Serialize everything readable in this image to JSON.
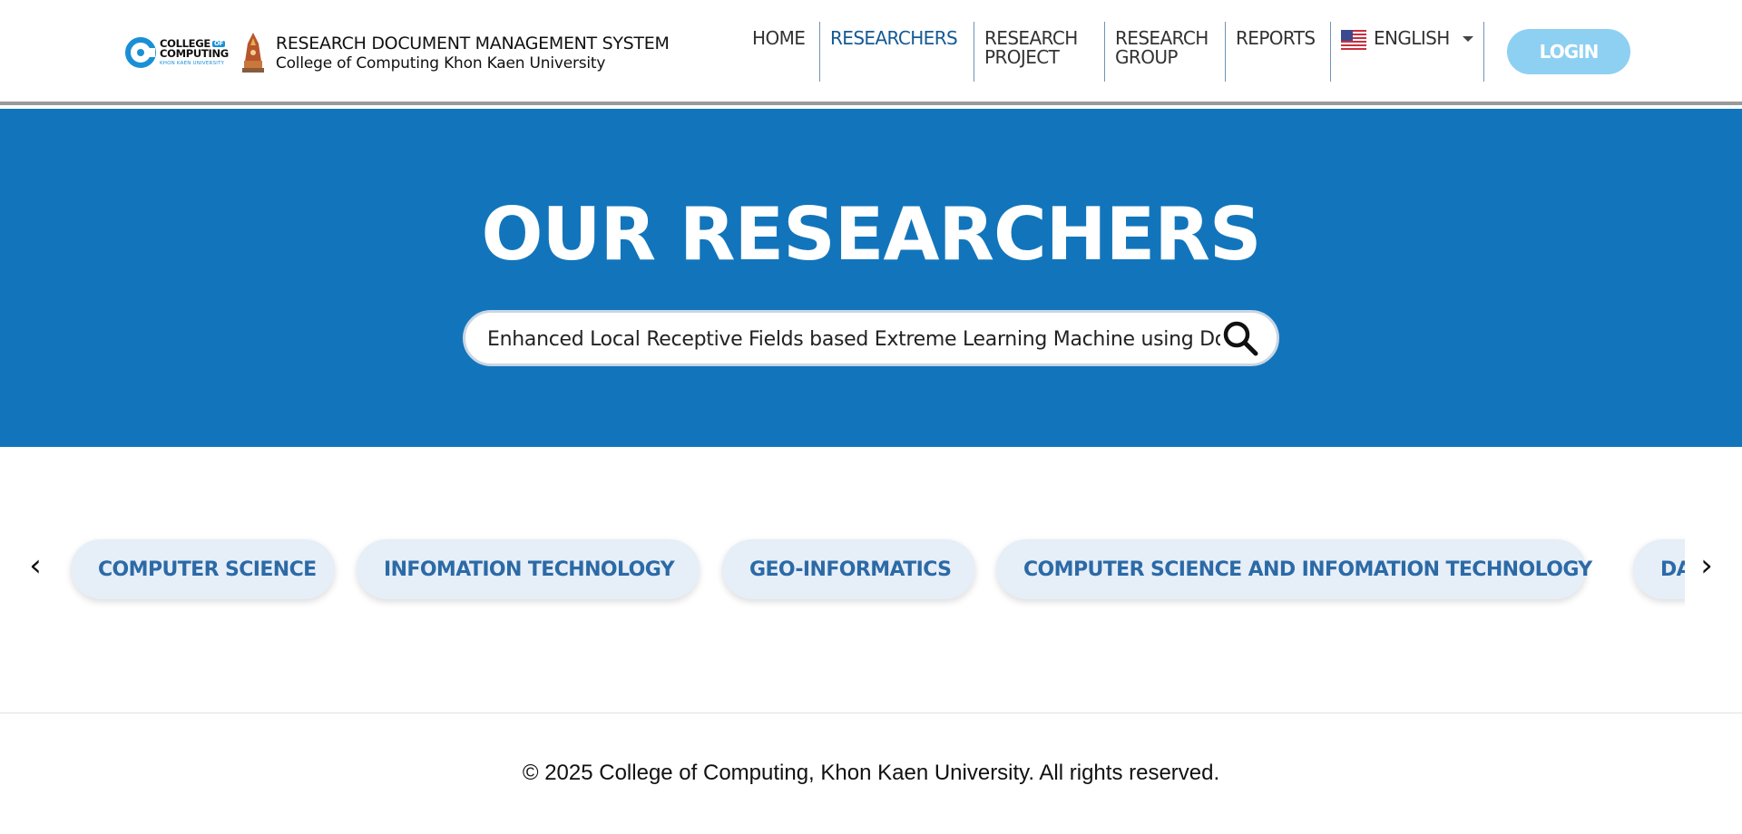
{
  "header": {
    "logo": {
      "line1": "COLLEGE",
      "badge": "OF",
      "line2": "COMPUTING",
      "line3": "KHON KAEN UNIVERSITY"
    },
    "title": "RESEARCH DOCUMENT MANAGEMENT SYSTEM",
    "subtitle": "College of Computing Khon Kaen University"
  },
  "nav": {
    "home": "HOME",
    "researchers": "RESEARCHERS",
    "research_project": [
      "RESEARCH",
      "PROJECT"
    ],
    "research_group": [
      "RESEARCH",
      "GROUP"
    ],
    "reports": "REPORTS",
    "language": "ENGLISH",
    "active": "researchers"
  },
  "login_label": "LOGIN",
  "hero": {
    "title": "OUR RESEARCHERS",
    "search_value": "Enhanced Local Receptive Fields based Extreme Learning Machine using Do"
  },
  "categories": {
    "prev_icon": "‹",
    "next_icon": "›",
    "items": [
      "COMPUTER SCIENCE",
      "INFOMATION TECHNOLOGY",
      "GEO-INFORMATICS",
      "COMPUTER SCIENCE AND INFOMATION TECHNOLOGY",
      "DA"
    ]
  },
  "footer": {
    "copyright": "© 2025 College of Computing, Khon Kaen University. All rights reserved."
  },
  "colors": {
    "hero_blue": "#1275bc",
    "nav_active": "#145a96",
    "login_bg": "#8dd0f2",
    "pill_bg": "#e6eef8",
    "pill_text": "#2c6aa6"
  }
}
